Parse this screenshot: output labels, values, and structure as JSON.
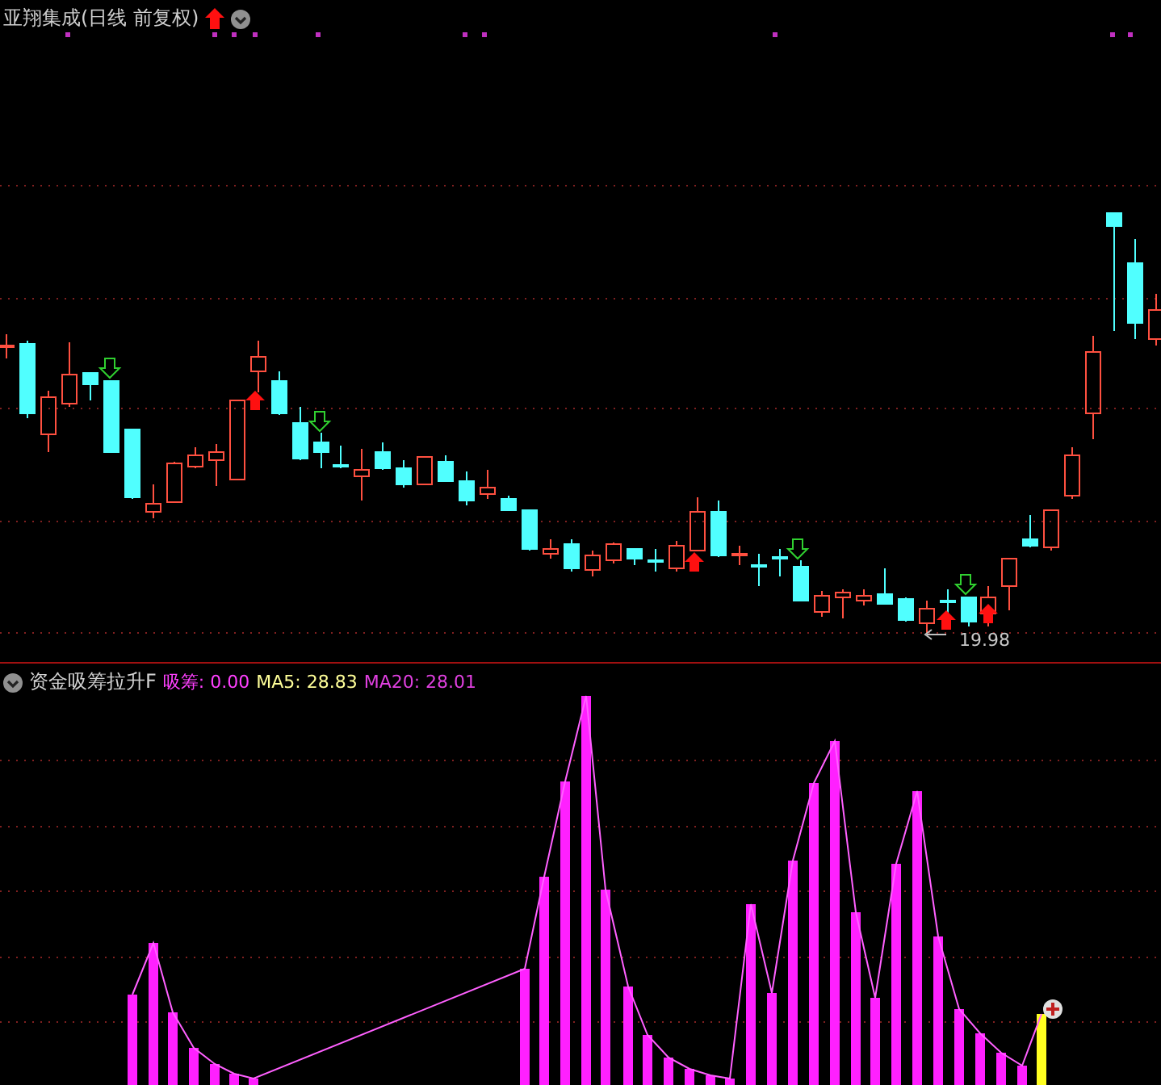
{
  "price_panel": {
    "title": "亚翔集成(日线 前复权)",
    "low_label": "19.98"
  },
  "indicator_panel": {
    "title": "资金吸筹拉升F",
    "legend": [
      {
        "text": "吸筹: 0.00",
        "color": "#ff40ff"
      },
      {
        "text": "MA5: 28.83",
        "color": "#ffff99"
      },
      {
        "text": "MA20: 28.01",
        "color": "#e040e0"
      }
    ]
  }
}
